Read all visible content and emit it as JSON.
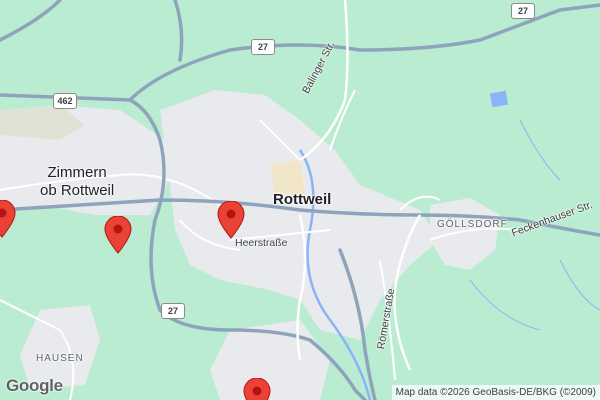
{
  "map": {
    "labels": {
      "zimmern": "Zimmern\nob Rottweil",
      "rottweil": "Rottweil",
      "hausen": "HAUSEN",
      "gollsdorf": "GÖLLSDORF",
      "heerstrasse": "Heerstraße",
      "balinger": "Balinger Str.",
      "romerstrasse": "Römerstraße",
      "feckenhauser": "Feckenhauser Str."
    },
    "shields": {
      "r27_top": "27",
      "r27_mid": "27",
      "r27_low": "27",
      "r462": "462"
    },
    "pin_count": 4,
    "attribution": "Map data ©2026 GeoBasis-DE/BKG (©2009)",
    "logo": "Google"
  },
  "colors": {
    "land": "#b9ecd0",
    "urban": "#e8eaed",
    "road": "#ffffff",
    "major_road": "#8fa3bd",
    "water": "#8ab4f8",
    "pin": "#ea4335"
  }
}
